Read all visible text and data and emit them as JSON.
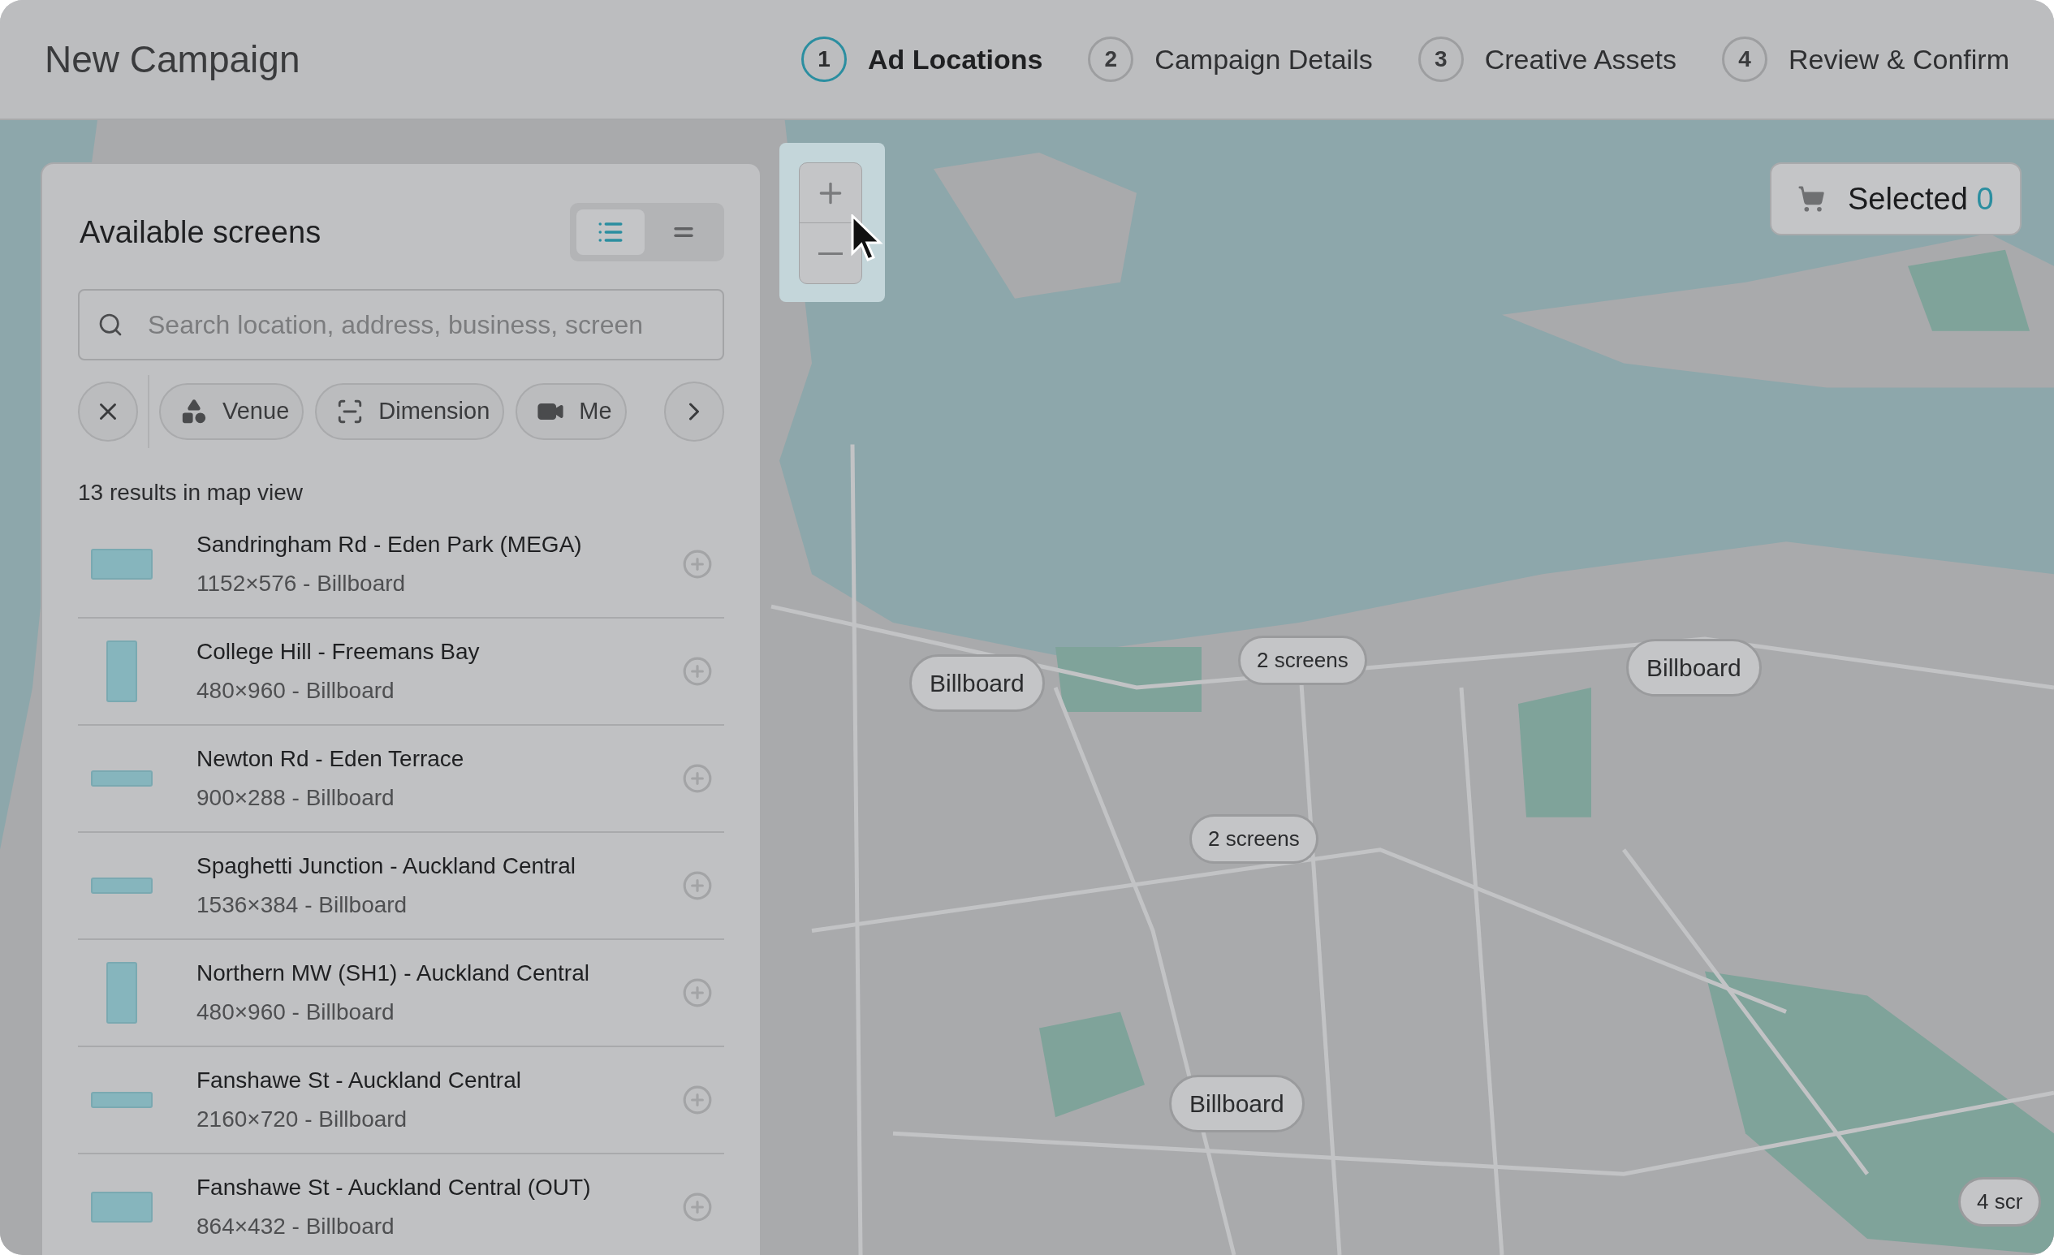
{
  "header": {
    "title": "New Campaign"
  },
  "steps": [
    {
      "number": "1",
      "label": "Ad Locations",
      "selected": true
    },
    {
      "number": "2",
      "label": "Campaign Details",
      "selected": false
    },
    {
      "number": "3",
      "label": "Creative Assets",
      "selected": false
    },
    {
      "number": "4",
      "label": "Review & Confirm",
      "selected": false
    }
  ],
  "panel": {
    "title": "Available screens",
    "view_toggle": [
      {
        "kind": "list",
        "selected": true
      },
      {
        "kind": "compact",
        "selected": false
      }
    ],
    "search": {
      "placeholder": "Search location, address, business, screen"
    },
    "filters": [
      {
        "label": "Venue"
      },
      {
        "label": "Dimension"
      },
      {
        "label": "Me"
      }
    ],
    "results_count": "13 results in map view",
    "screens": [
      {
        "name": "Sandringham Rd - Eden Park (MEGA)",
        "detail": "1152×576 - Billboard",
        "kind": "landscape"
      },
      {
        "name": "College Hill - Freemans Bay",
        "detail": "480×960 - Billboard",
        "kind": "portrait"
      },
      {
        "name": "Newton Rd - Eden Terrace",
        "detail": "900×288 - Billboard",
        "kind": "wide"
      },
      {
        "name": "Spaghetti Junction - Auckland Central",
        "detail": "1536×384 - Billboard",
        "kind": "wide"
      },
      {
        "name": "Northern MW (SH1) - Auckland Central",
        "detail": "480×960 - Billboard",
        "kind": "portrait"
      },
      {
        "name": "Fanshawe St - Auckland Central",
        "detail": "2160×720 - Billboard",
        "kind": "wide"
      },
      {
        "name": "Fanshawe St - Auckland Central (OUT)",
        "detail": "864×432 - Billboard",
        "kind": "landscape"
      }
    ]
  },
  "map": {
    "selected": {
      "label": "Selected",
      "count": "0"
    },
    "markers": [
      {
        "label": "Billboard",
        "kind": "single"
      },
      {
        "label": "2 screens",
        "kind": "cluster"
      },
      {
        "label": "Billboard",
        "kind": "single"
      },
      {
        "label": "2 screens",
        "kind": "cluster"
      },
      {
        "label": "Billboard",
        "kind": "single"
      },
      {
        "label": "4 scr",
        "kind": "cluster"
      }
    ]
  }
}
